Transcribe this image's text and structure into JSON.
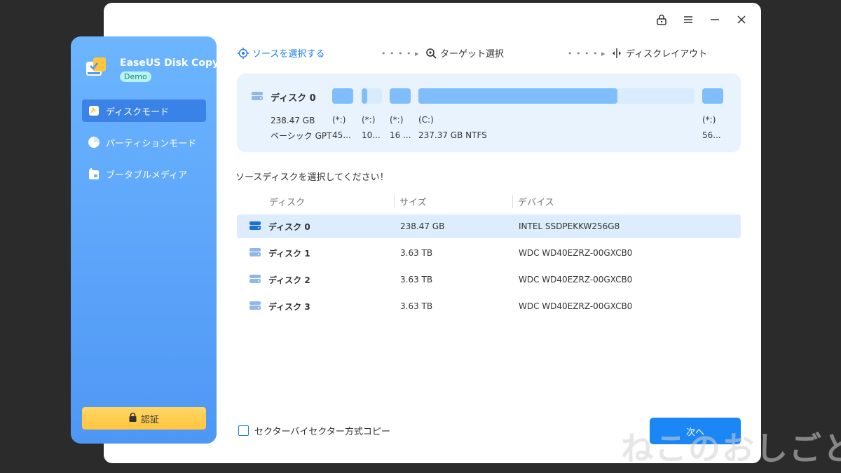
{
  "app": {
    "name": "EaseUS Disk Copy",
    "badge": "Demo"
  },
  "sidebar": {
    "items": [
      {
        "label": "ディスクモード",
        "icon": "disk-mode-icon",
        "active": true
      },
      {
        "label": "パーティションモード",
        "icon": "partition-pie-icon",
        "active": false
      },
      {
        "label": "ブータブルメディア",
        "icon": "bootable-media-icon",
        "active": false
      }
    ],
    "auth_label": "認証"
  },
  "titlebar": {
    "icons": [
      "lock-icon",
      "menu-icon",
      "minimize-icon",
      "close-icon"
    ]
  },
  "steps": {
    "source": "ソースを選択する",
    "target": "ターゲット選択",
    "layout": "ディスクレイアウト",
    "separator": "• • • • ▸"
  },
  "disk_panel": {
    "name": "ディスク 0",
    "size": "238.47 GB",
    "type": "ベーシック GPT",
    "partitions": [
      {
        "label": "(*:)",
        "detail": "45..."
      },
      {
        "label": "(*:)",
        "detail": "10..."
      },
      {
        "label": "(*:)",
        "detail": "16 ..."
      },
      {
        "label": "(C:)",
        "detail": "237.37 GB NTFS",
        "used_fraction": 0.72
      },
      {
        "label": "(*:)",
        "detail": "56..."
      }
    ]
  },
  "prompt": "ソースディスクを選択してください！",
  "table": {
    "headers": [
      "ディスク",
      "サイズ",
      "デバイス"
    ],
    "rows": [
      {
        "disk": "ディスク 0",
        "size": "238.47 GB",
        "device": "INTEL SSDPEKKW256G8",
        "selected": true
      },
      {
        "disk": "ディスク 1",
        "size": "3.63 TB",
        "device": "WDC WD40EZRZ-00GXCB0",
        "selected": false
      },
      {
        "disk": "ディスク 2",
        "size": "3.63 TB",
        "device": "WDC WD40EZRZ-00GXCB0",
        "selected": false
      },
      {
        "disk": "ディスク 3",
        "size": "3.63 TB",
        "device": "WDC WD40EZRZ-00GXCB0",
        "selected": false
      }
    ]
  },
  "sector_copy_label": "セクターバイセクター方式コピー",
  "next_label": "次へ",
  "watermark": "ねこのおしごと",
  "colors": {
    "accent": "#1b86f5",
    "sidebar_top": "#6cb5ff",
    "sidebar_bottom": "#4e97f5",
    "auth_button": "#ffc53d",
    "panel_bg": "#e8f3fe",
    "partition": "#7fbefb"
  }
}
